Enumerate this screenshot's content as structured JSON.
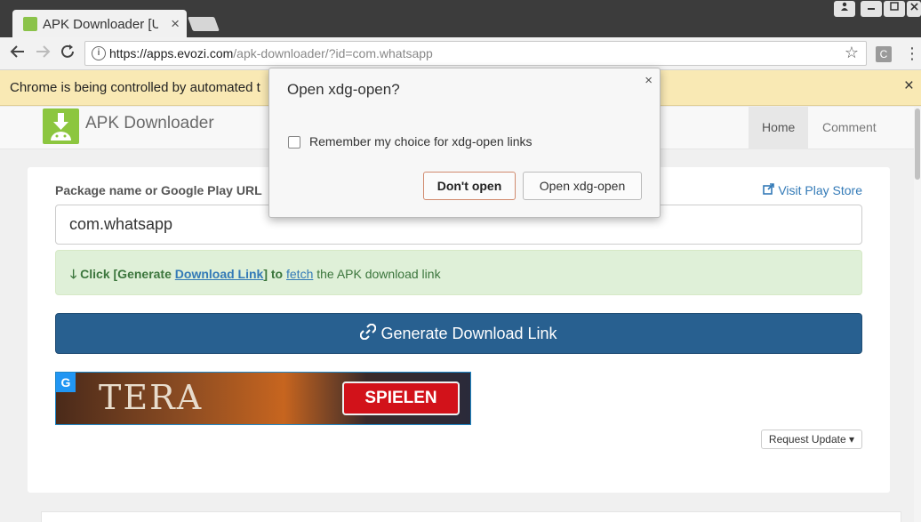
{
  "browser": {
    "tab_title": "APK Downloader [U",
    "tab_close": "×",
    "url_host": "https://apps.evozi.com",
    "url_path": "/apk-downloader/?id=com.whatsapp",
    "infobar_text": "Chrome is being controlled by automated t",
    "infobar_close": "×",
    "ext_label": "C",
    "menu_icon": "⋮",
    "star_icon": "☆"
  },
  "site": {
    "brand": "APK Downloader",
    "nav": [
      {
        "label": "Home",
        "active": true
      },
      {
        "label": "Comment",
        "active": false
      }
    ]
  },
  "form": {
    "label": "Package name or Google Play URL",
    "visit_link": "Visit Play Store",
    "input_value": "com.whatsapp",
    "alert": {
      "prefix": "Click [Generate ",
      "link1": "Download Link",
      "mid": "] to ",
      "link2": "fetch",
      "suffix": " the APK download link"
    },
    "generate_button": "Generate Download Link",
    "request_update": "Request Update ▾"
  },
  "ad": {
    "badge": "G",
    "game_name": "TERA",
    "cta": "SPIELEN"
  },
  "dialog": {
    "title": "Open xdg-open?",
    "close": "×",
    "checkbox_label": "Remember my choice for xdg-open links",
    "checkbox_checked": false,
    "dont_open": "Don't open",
    "open": "Open xdg-open"
  },
  "colors": {
    "primary_button": "#286090",
    "alert_bg": "#dff0d8",
    "infobar_bg": "#f9e9b4",
    "link": "#337ab7"
  }
}
